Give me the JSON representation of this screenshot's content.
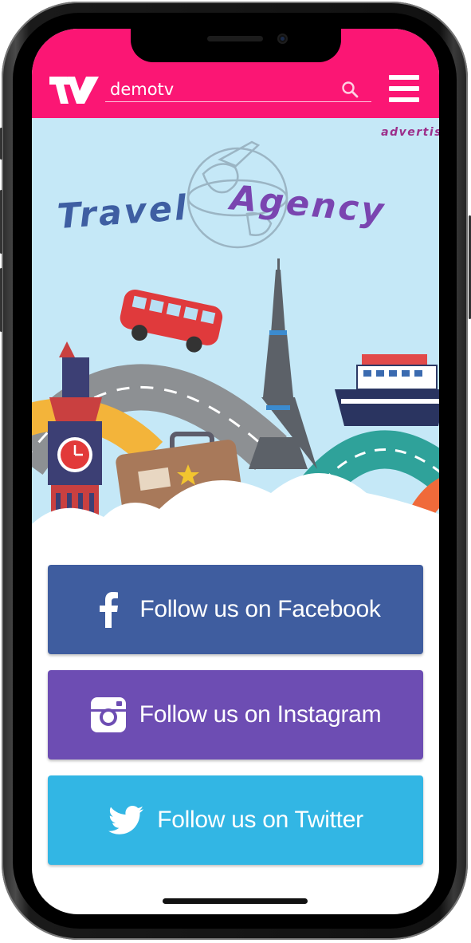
{
  "header": {
    "search_value": "demotv",
    "brand_color": "#fb1674",
    "logo_icon": "tv-logo-icon",
    "search_icon": "search-icon",
    "menu_icon": "hamburger-menu-icon"
  },
  "banner": {
    "title_word1": "Travel",
    "title_word2": "Agency",
    "ad_label": "advertis",
    "background": "#c5e8f7"
  },
  "social": {
    "facebook_label": "Follow us on Facebook",
    "instagram_label": "Follow us on Instagram",
    "twitter_label": "Follow us on Twitter",
    "facebook_color": "#3f5d9f",
    "instagram_color": "#6d4db3",
    "twitter_color": "#32b6e4"
  }
}
